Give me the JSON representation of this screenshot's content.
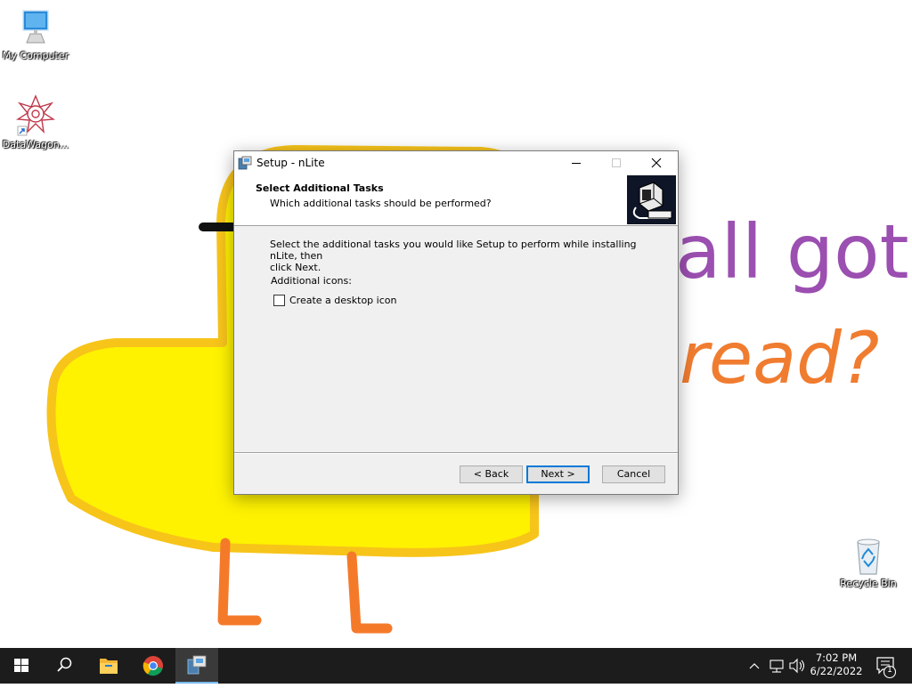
{
  "desktop": {
    "icons": [
      {
        "label": "My Computer"
      },
      {
        "label": "DataWagon..."
      },
      {
        "label": "Recycle Bin"
      }
    ],
    "wallpaper_text": {
      "line1": "all got",
      "line2": "read?"
    }
  },
  "dialog": {
    "title": "Setup - nLite",
    "header_title": "Select Additional Tasks",
    "header_subtitle": "Which additional tasks should be performed?",
    "intro_line1": "Select the additional tasks you would like Setup to perform while installing nLite, then",
    "intro_line2": "click Next.",
    "section_label": "Additional icons:",
    "checkbox_label": "Create a desktop icon",
    "checkbox_checked": false,
    "buttons": {
      "back": "< Back",
      "next": "Next >",
      "cancel": "Cancel"
    }
  },
  "taskbar": {
    "time": "7:02 PM",
    "date": "6/22/2022",
    "notification_count": "1",
    "pinned": [
      "start-icon",
      "search-icon",
      "file-explorer-icon",
      "chrome-icon",
      "nlite-setup-icon"
    ]
  },
  "colors": {
    "accent": "#0078d7",
    "taskbar": "#1c1c1c",
    "wallpaper_purple": "#9b4fb0",
    "wallpaper_orange": "#f07c30",
    "duck_yellow": "#fef200"
  }
}
